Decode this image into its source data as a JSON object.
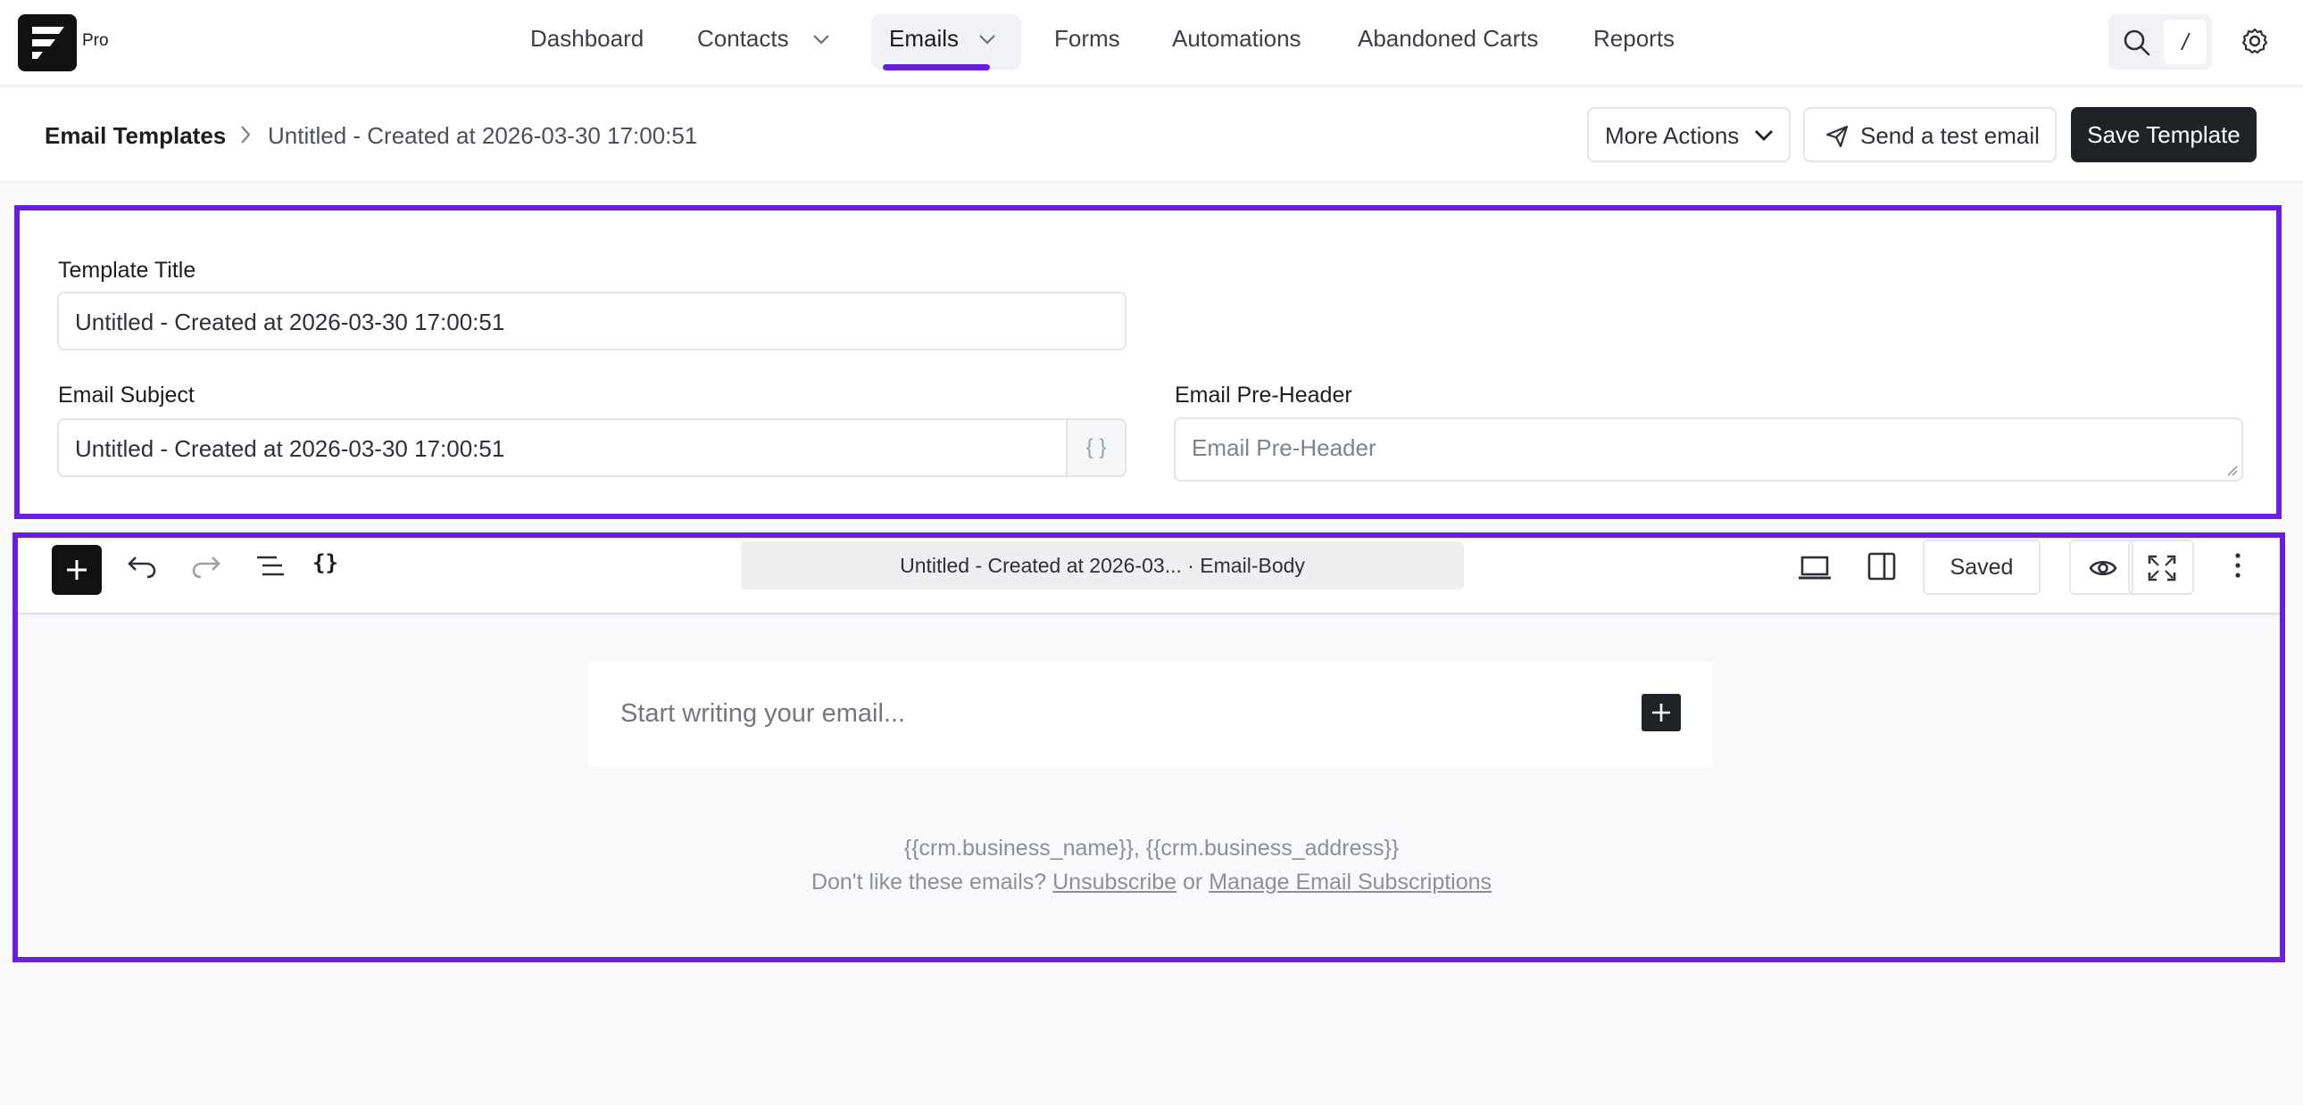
{
  "nav": {
    "brand_badge": "Pro",
    "items": [
      {
        "label": "Dashboard"
      },
      {
        "label": "Contacts"
      },
      {
        "label": "Emails"
      },
      {
        "label": "Forms"
      },
      {
        "label": "Automations"
      },
      {
        "label": "Abandoned Carts"
      },
      {
        "label": "Reports"
      }
    ],
    "active": "Emails",
    "accent_color": "#6a1fdc",
    "search_shortcut": "/"
  },
  "breadcrumb": {
    "root": "Email Templates",
    "current": "Untitled - Created at 2026-03-30 17:00:51"
  },
  "actions": {
    "more_actions": "More Actions",
    "send_test": "Send a test email",
    "save": "Save Template"
  },
  "form": {
    "title_label": "Template Title",
    "title_value": "Untitled - Created at 2026-03-30 17:00:51",
    "subject_label": "Email Subject",
    "subject_value": "Untitled - Created at 2026-03-30 17:00:51",
    "subject_addon": "{ }",
    "preheader_label": "Email Pre-Header",
    "preheader_placeholder": "Email Pre-Header"
  },
  "editor": {
    "doc_title": "Untitled - Created at 2026-03... · Email-Body",
    "saved_label": "Saved",
    "shortcode_icon": "{}",
    "placeholder": "Start writing your email...",
    "footer_line1": "{{crm.business_name}}, {{crm.business_address}}",
    "footer_prefix": "Don't like these emails?",
    "unsubscribe": "Unsubscribe",
    "footer_or": "or",
    "manage_link": "Manage Email Subscriptions"
  }
}
